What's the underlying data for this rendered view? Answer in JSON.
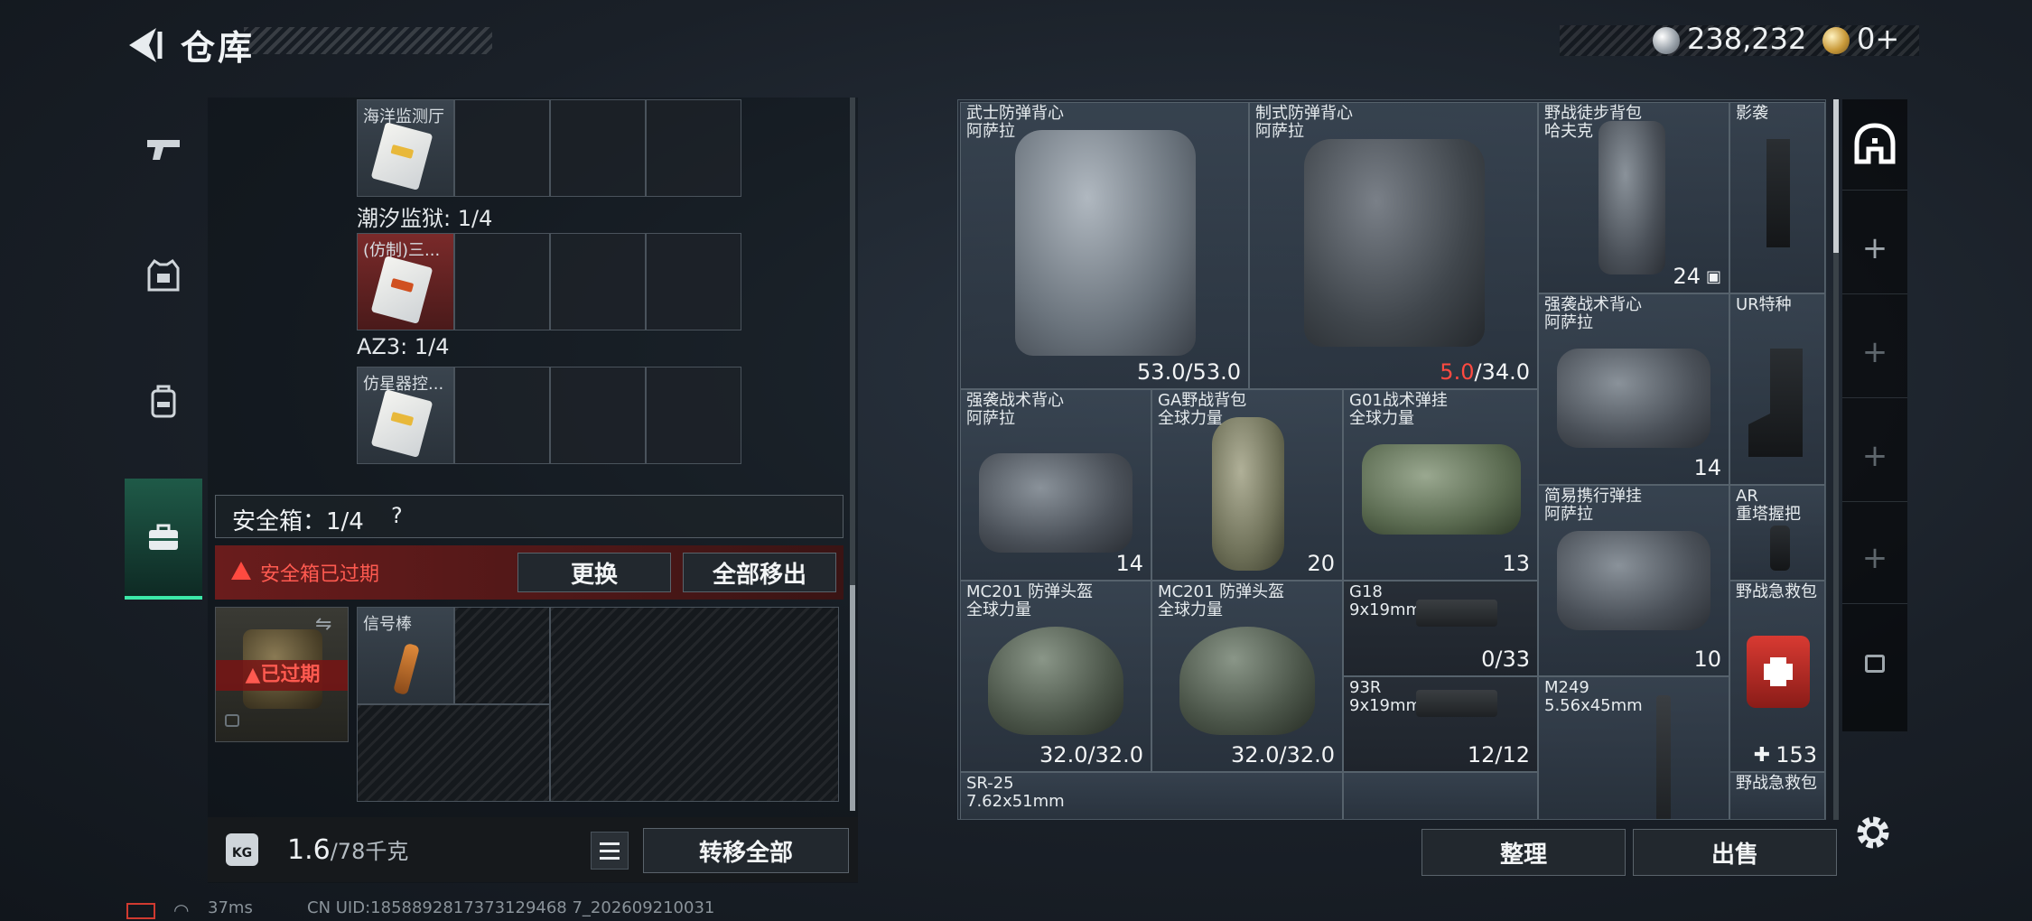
{
  "header": {
    "title": "仓库"
  },
  "currency": {
    "silver": "238,232",
    "gold": "0+"
  },
  "leftnav": [
    "weapons",
    "equipment",
    "backpack",
    "safebox"
  ],
  "left_groups": [
    {
      "label": "",
      "first_slot": "海洋监测厅",
      "red": false,
      "orange": false
    },
    {
      "label": "潮汐监狱: 1/4",
      "first_slot": "(仿制)三...",
      "red": true,
      "orange": true
    },
    {
      "label": "AZ3: 1/4",
      "first_slot": "仿星器控...",
      "red": false,
      "orange": false
    }
  ],
  "safebox": {
    "label": "安全箱：1/4",
    "help": "?",
    "expired_text": "安全箱已过期",
    "replace_btn": "更换",
    "remove_all_btn": "全部移出",
    "expired_tag": "已过期",
    "item": "信号棒"
  },
  "weight": {
    "current": "1.6",
    "max": "/78千克",
    "transfer_all": "转移全部"
  },
  "grid": {
    "vest1": {
      "name": "武士防弹背心\n阿萨拉",
      "value": "53.0/53.0"
    },
    "vest2": {
      "name": "制式防弹背心\n阿萨拉",
      "value_red": "5.0",
      "value_rest": "/34.0"
    },
    "pack1": {
      "name": "野战徒步背包\n哈夫克",
      "count": "24"
    },
    "ying": {
      "name": "影袭"
    },
    "rig_r": {
      "name": "强袭战术背心\n阿萨拉",
      "count": "14"
    },
    "ur": {
      "name": "UR特种"
    },
    "rig_l": {
      "name": "强袭战术背心\n阿萨拉",
      "count": "14"
    },
    "ga": {
      "name": "GA野战背包\n全球力量",
      "count": "20"
    },
    "g01": {
      "name": "G01战术弹挂\n全球力量",
      "count": "13"
    },
    "simple": {
      "name": "简易携行弹挂\n阿萨拉",
      "count": "10"
    },
    "ar": {
      "name": "AR\n重塔握把"
    },
    "helmet1": {
      "name": "MC201 防弹头盔\n全球力量",
      "value": "32.0/32.0"
    },
    "helmet2": {
      "name": "MC201 防弹头盔\n全球力量",
      "value": "32.0/32.0"
    },
    "g18": {
      "name": "G18\n9x19mm",
      "value": "0/33"
    },
    "medkit": {
      "name": "野战急救包",
      "count": "153"
    },
    "r93": {
      "name": "93R\n9x19mm",
      "value": "12/12"
    },
    "m249": {
      "name": "M249\n5.56x45mm"
    },
    "sr25": {
      "name": "SR-25\n7.62x51mm"
    },
    "medkit2": {
      "name": "野战急救包"
    }
  },
  "actions": {
    "organize": "整理",
    "sell": "出售"
  },
  "footer": {
    "ping": "37ms",
    "uid": "CN UID:1858892817373129468 7_202609210031"
  }
}
